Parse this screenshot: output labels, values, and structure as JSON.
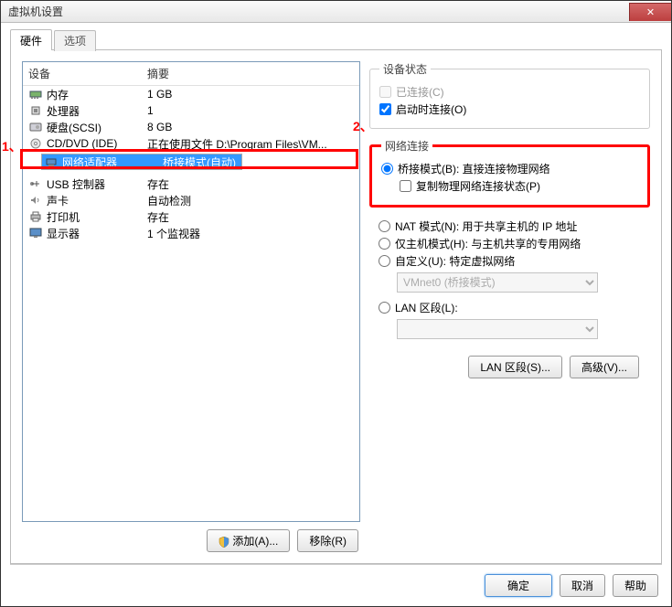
{
  "window": {
    "title": "虚拟机设置"
  },
  "tabs": {
    "hardware": "硬件",
    "options": "选项"
  },
  "list": {
    "hdr_device": "设备",
    "hdr_summary": "摘要",
    "rows": [
      {
        "name": "内存",
        "summary": "1 GB",
        "icon": "memory",
        "sel": false
      },
      {
        "name": "处理器",
        "summary": "1",
        "icon": "cpu",
        "sel": false
      },
      {
        "name": "硬盘(SCSI)",
        "summary": "8 GB",
        "icon": "disk",
        "sel": false
      },
      {
        "name": "CD/DVD (IDE)",
        "summary": "正在使用文件 D:\\Program Files\\VM...",
        "icon": "cd",
        "sel": false
      },
      {
        "name": "网络适配器",
        "summary": "桥接模式(自动)",
        "icon": "net",
        "sel": true
      },
      {
        "name": "USB 控制器",
        "summary": "存在",
        "icon": "usb",
        "sel": false
      },
      {
        "name": "声卡",
        "summary": "自动检测",
        "icon": "sound",
        "sel": false
      },
      {
        "name": "打印机",
        "summary": "存在",
        "icon": "printer",
        "sel": false
      },
      {
        "name": "显示器",
        "summary": "1 个监视器",
        "icon": "display",
        "sel": false
      }
    ]
  },
  "left_buttons": {
    "add": "添加(A)...",
    "remove": "移除(R)"
  },
  "status": {
    "legend": "设备状态",
    "connected": "已连接(C)",
    "connect_on": "启动时连接(O)"
  },
  "netconn": {
    "legend": "网络连接",
    "bridged": "桥接模式(B): 直接连接物理网络",
    "replicate": "复制物理网络连接状态(P)",
    "nat": "NAT 模式(N): 用于共享主机的 IP 地址",
    "hostonly": "仅主机模式(H): 与主机共享的专用网络",
    "custom": "自定义(U): 特定虚拟网络",
    "custom_sel": "VMnet0 (桥接模式)",
    "lanseg": "LAN 区段(L):",
    "btn_lan": "LAN 区段(S)...",
    "btn_adv": "高级(V)..."
  },
  "footer": {
    "ok": "确定",
    "cancel": "取消",
    "help": "帮助"
  },
  "annot": {
    "one": "1、",
    "two": "2、"
  }
}
